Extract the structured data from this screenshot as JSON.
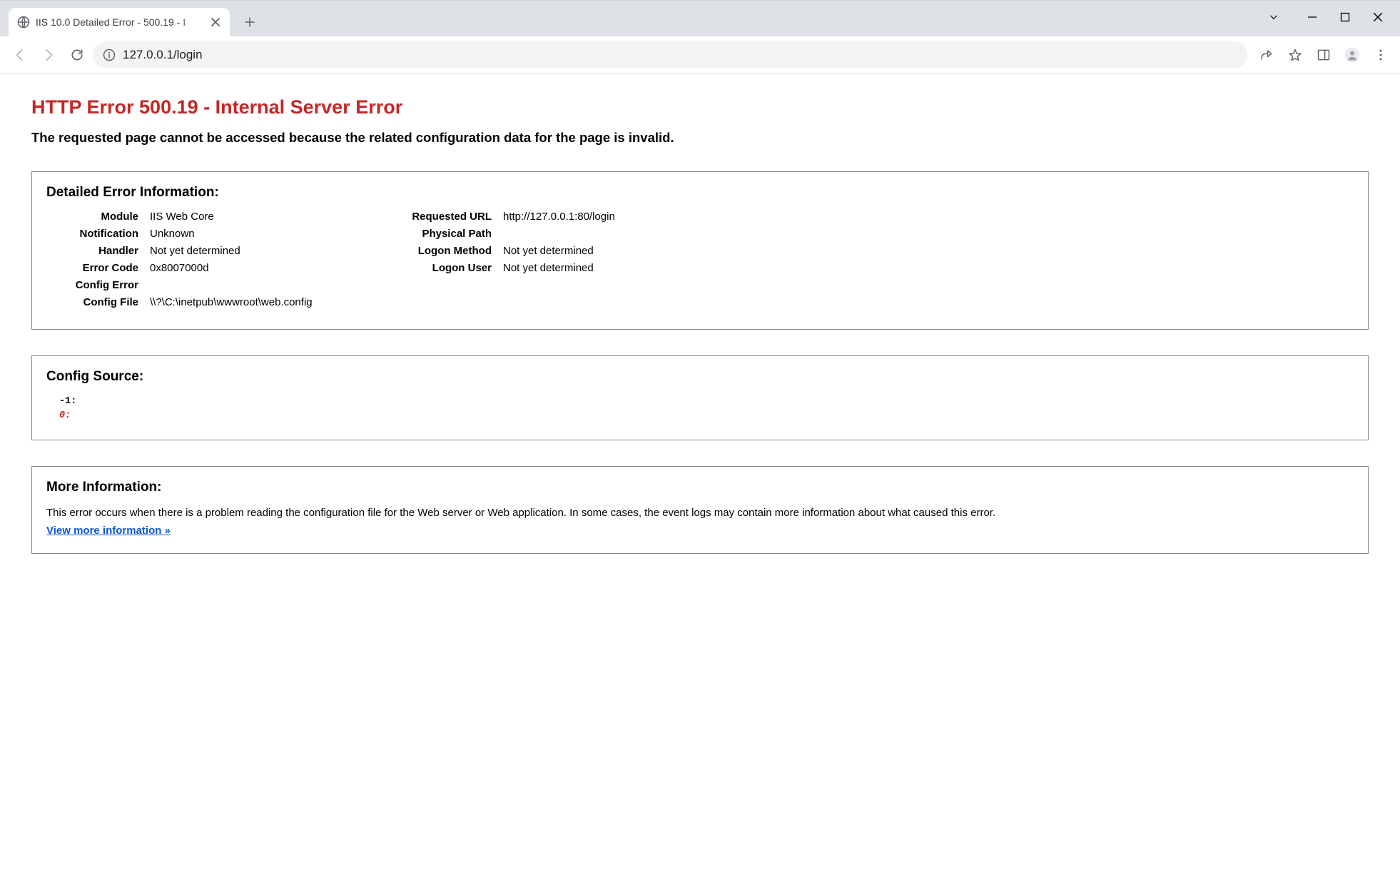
{
  "browser": {
    "tab_title": "IIS 10.0 Detailed Error - 500.19 - I",
    "url": "127.0.0.1/login"
  },
  "page": {
    "title": "HTTP Error 500.19 - Internal Server Error",
    "subtitle": "The requested page cannot be accessed because the related configuration data for the page is invalid.",
    "detail_header": "Detailed Error Information:",
    "details_left": [
      {
        "k": "Module",
        "v": "IIS Web Core"
      },
      {
        "k": "Notification",
        "v": "Unknown"
      },
      {
        "k": "Handler",
        "v": "Not yet determined"
      },
      {
        "k": "Error Code",
        "v": "0x8007000d"
      },
      {
        "k": "Config Error",
        "v": ""
      },
      {
        "k": "Config File",
        "v": "\\\\?\\C:\\inetpub\\wwwroot\\web.config"
      }
    ],
    "details_right": [
      {
        "k": "Requested URL",
        "v": "http://127.0.0.1:80/login"
      },
      {
        "k": "Physical Path",
        "v": ""
      },
      {
        "k": "Logon Method",
        "v": "Not yet determined"
      },
      {
        "k": "Logon User",
        "v": "Not yet determined"
      }
    ],
    "config_source_header": "Config Source:",
    "config_source": {
      "line1": "-1:",
      "line2": "0:"
    },
    "more_info_header": "More Information:",
    "more_info_text": "This error occurs when there is a problem reading the configuration file for the Web server or Web application. In some cases, the event logs may contain more information about what caused this error.",
    "more_info_link_label": "View more information »"
  }
}
